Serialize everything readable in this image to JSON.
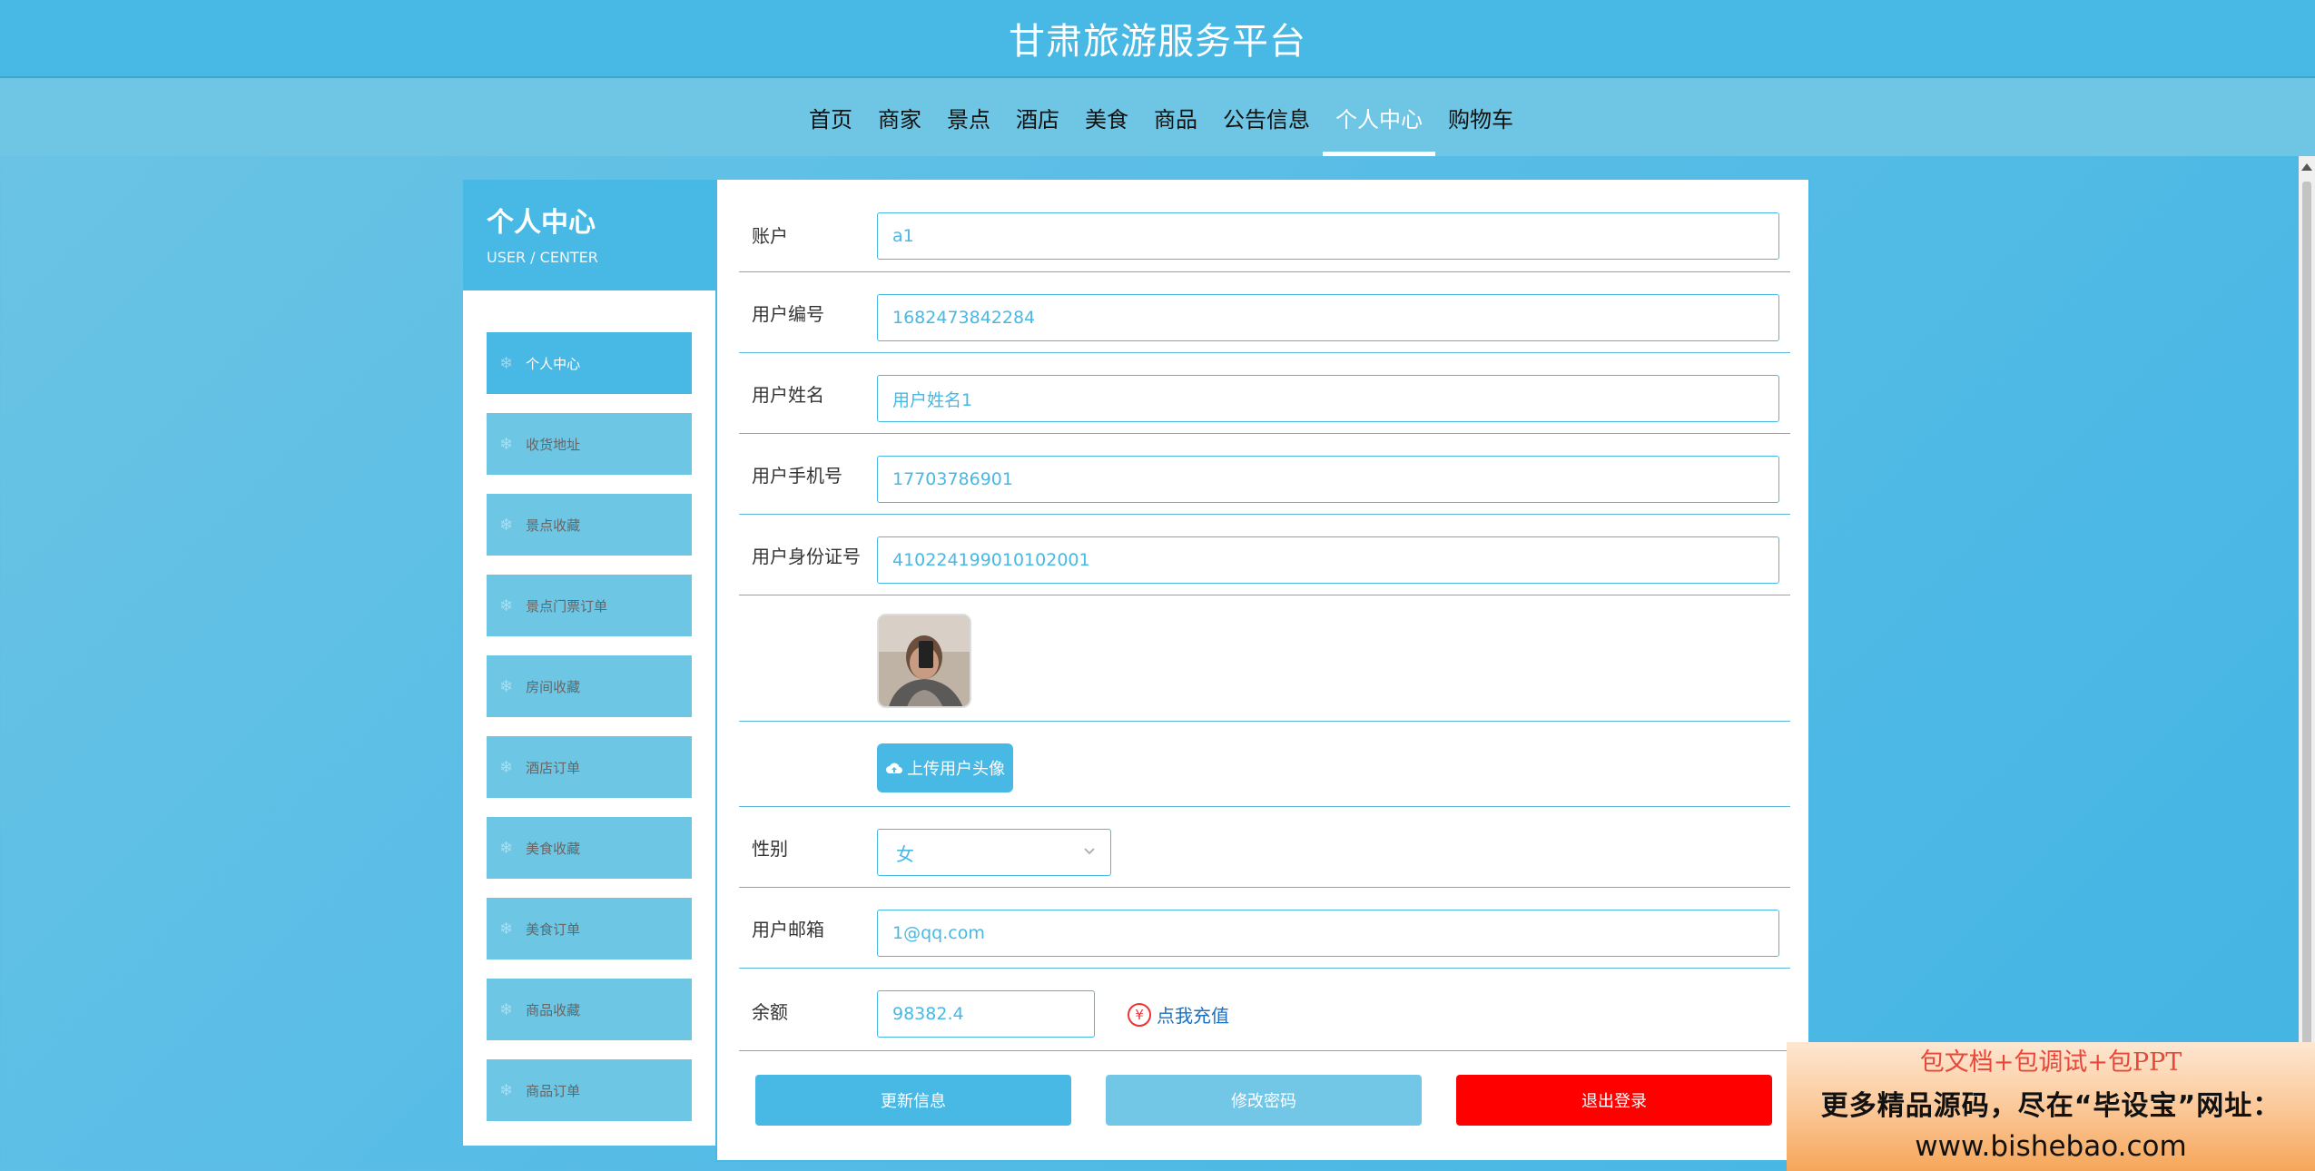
{
  "header": {
    "title": "甘肃旅游服务平台"
  },
  "nav": {
    "items": [
      "首页",
      "商家",
      "景点",
      "酒店",
      "美食",
      "商品",
      "公告信息",
      "个人中心",
      "购物车"
    ],
    "active": "个人中心"
  },
  "sidebar": {
    "title": "个人中心",
    "subtitle": "USER / CENTER",
    "items": [
      "个人中心",
      "收货地址",
      "景点收藏",
      "景点门票订单",
      "房间收藏",
      "酒店订单",
      "美食收藏",
      "美食订单",
      "商品收藏",
      "商品订单"
    ],
    "active": "个人中心"
  },
  "form": {
    "account": {
      "label": "账户",
      "value": "a1"
    },
    "user_no": {
      "label": "用户编号",
      "value": "1682473842284"
    },
    "user_name": {
      "label": "用户姓名",
      "value": "用户姓名1"
    },
    "phone": {
      "label": "用户手机号",
      "value": "17703786901"
    },
    "id_card": {
      "label": "用户身份证号",
      "value": "410224199010102001"
    },
    "upload_label": "上传用户头像",
    "gender": {
      "label": "性别",
      "value": "女"
    },
    "email": {
      "label": "用户邮箱",
      "value": "1@qq.com"
    },
    "balance": {
      "label": "余额",
      "value": "98382.4",
      "recharge_label": "点我充值",
      "recharge_icon": "¥"
    }
  },
  "buttons": {
    "update": "更新信息",
    "change_password": "修改密码",
    "logout": "退出登录"
  },
  "promo": {
    "line1": "包文档+包调试+包PPT",
    "line2": "更多精品源码，尽在“毕设宝”网址：",
    "line3": "www.bishebao.com"
  },
  "colors": {
    "primary": "#48b8e4",
    "secondary": "#6cc6e4",
    "danger": "#ff0000",
    "link": "#1a6fc0"
  }
}
